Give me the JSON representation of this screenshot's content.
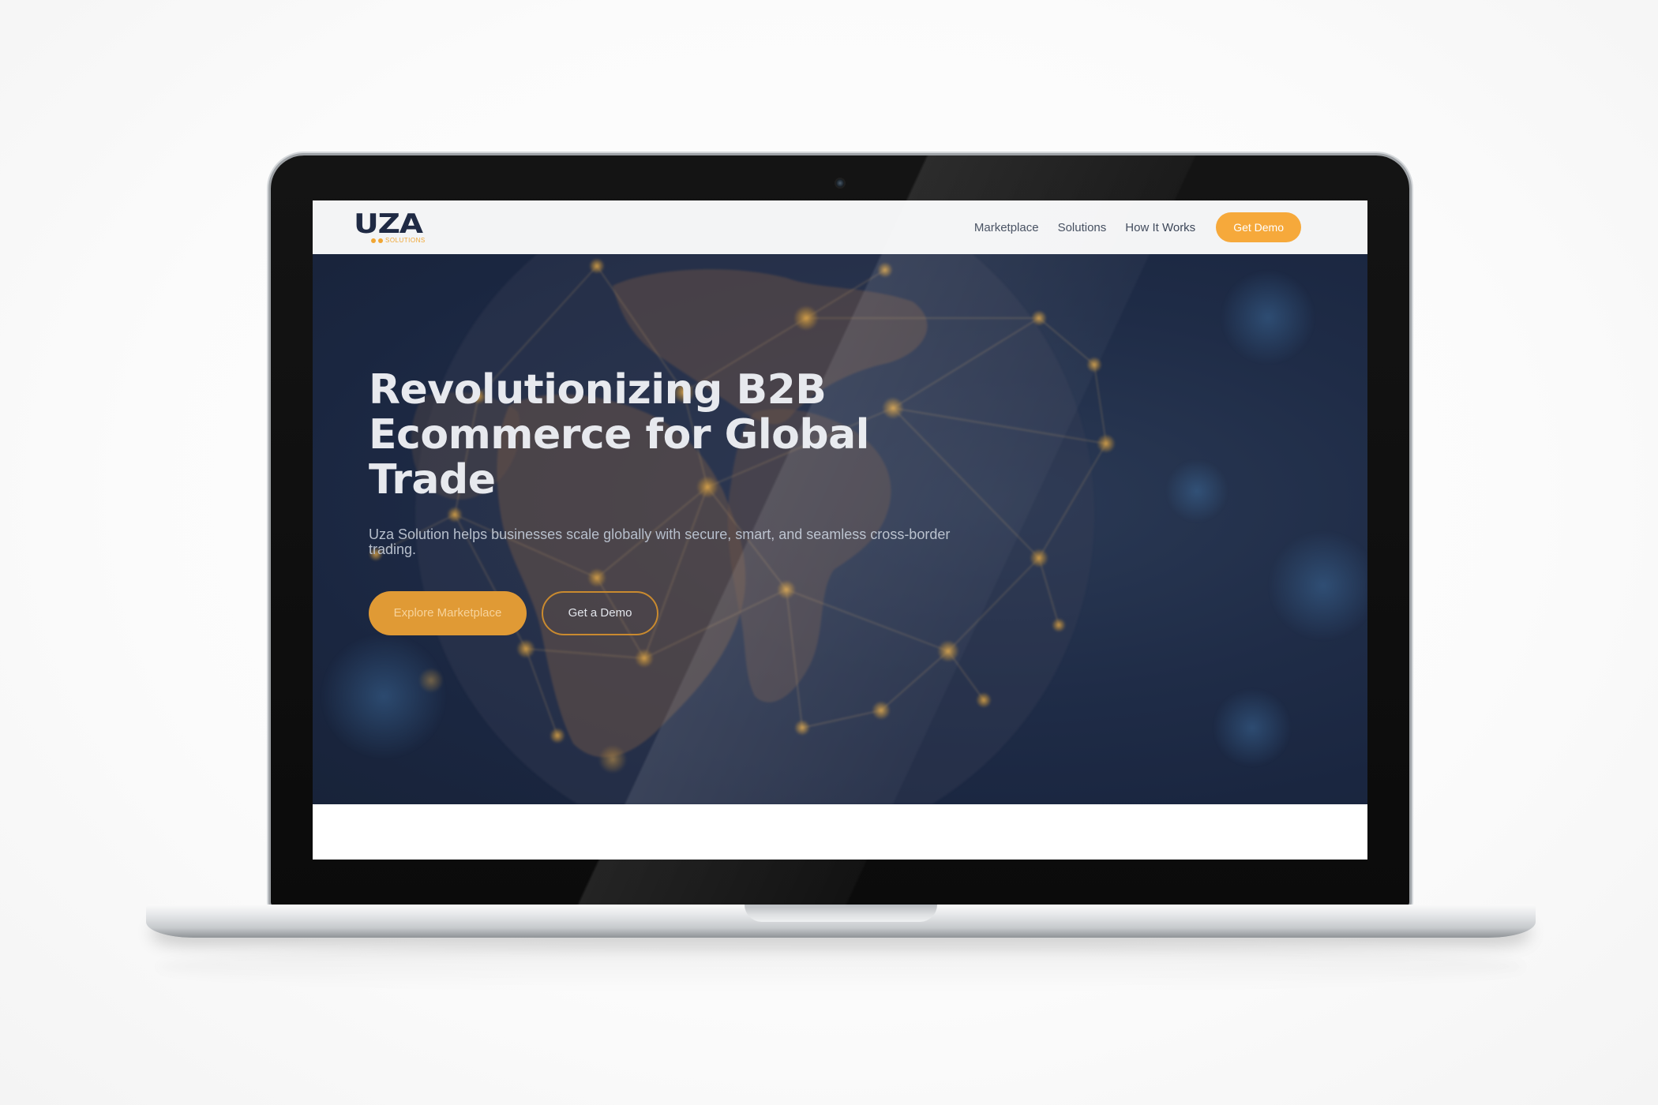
{
  "site": {
    "logo": {
      "wordmark": "UZA",
      "tagline": "SOLUTIONS"
    },
    "nav": {
      "items": [
        {
          "label": "Marketplace"
        },
        {
          "label": "Solutions"
        },
        {
          "label": "How It Works"
        }
      ],
      "cta_label": "Get Demo"
    },
    "hero": {
      "title_lines": [
        "Revolutionizing B2B",
        "Ecommerce for Global",
        "Trade"
      ],
      "subtitle": "Uza Solution helps businesses scale globally with secure, smart, and seamless cross-border trading.",
      "primary_button": "Explore Marketplace",
      "secondary_button": "Get a Demo"
    }
  },
  "colors": {
    "accent": "#f6a93b",
    "hero_background": "#1f2c47",
    "header_background": "#f3f4f5",
    "logo_navy": "#1f2a44"
  },
  "icons": [
    "camera-icon"
  ]
}
